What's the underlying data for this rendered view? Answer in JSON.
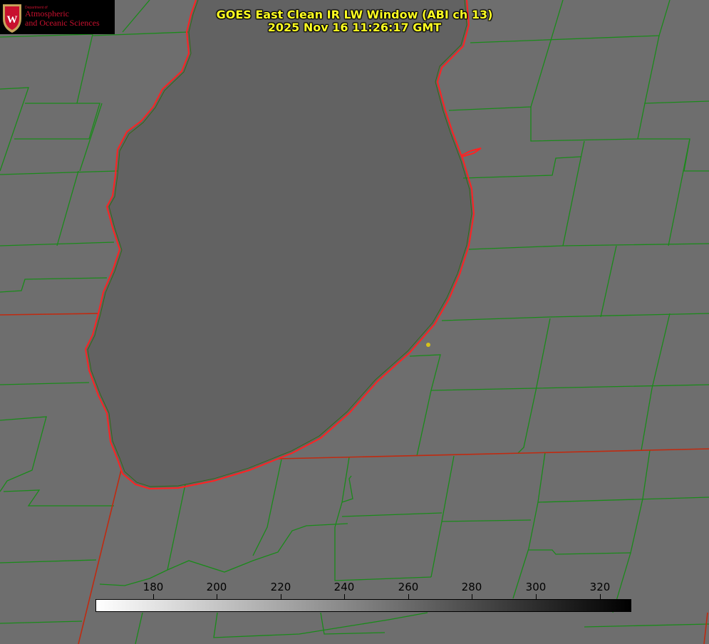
{
  "title": {
    "line1": "GOES East Clean IR LW Window (ABI ch 13)",
    "line2": "2025 Nov 16 11:26:17 GMT"
  },
  "logo": {
    "department": "Department of",
    "line1": "Atmospheric",
    "line2": "and Oceanic Sciences",
    "emblem": "uw-crest-icon"
  },
  "colorbar": {
    "ticks": [
      "180",
      "200",
      "220",
      "240",
      "260",
      "280",
      "300",
      "320"
    ],
    "gradient": [
      "#ffffff",
      "#000000"
    ]
  },
  "map_colors": {
    "background": "#6e6e6e",
    "lake": "#626262",
    "county_lines": "#1a8a1a",
    "state_lines": "#c02a10",
    "coastline": "#ff2222",
    "marker": "#d6c21a"
  }
}
